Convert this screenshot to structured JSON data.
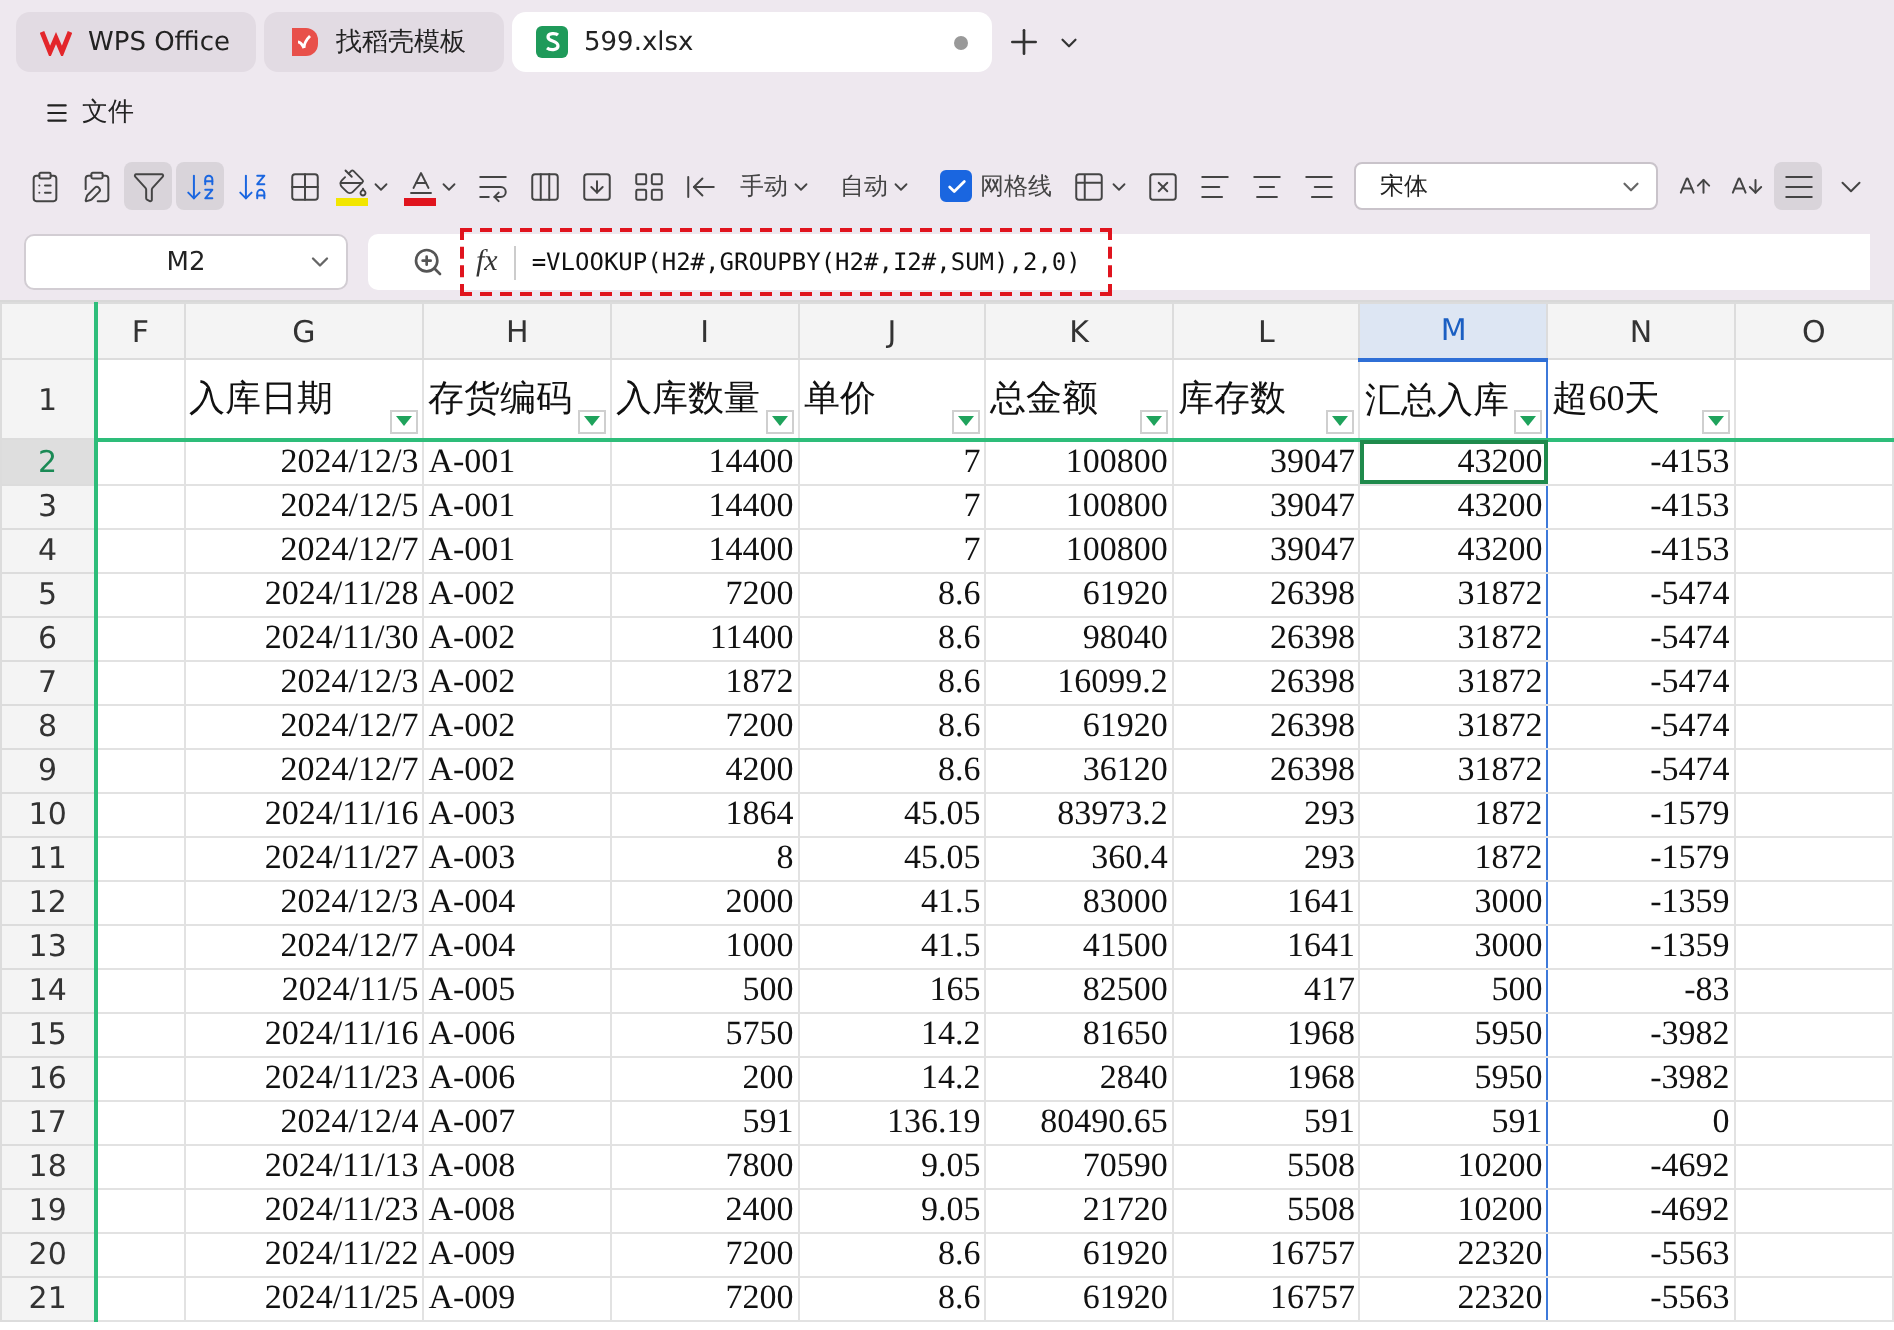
{
  "tabs": [
    {
      "label": "WPS Office",
      "kind": "wps",
      "selected": false,
      "modified": false
    },
    {
      "label": "找稻壳模板",
      "kind": "docer",
      "selected": false,
      "modified": false
    },
    {
      "label": "599.xlsx",
      "kind": "sheet",
      "selected": true,
      "modified": true
    }
  ],
  "menu": {
    "label": "文件"
  },
  "toolbar": {
    "items": [
      {
        "kind": "icon",
        "pressed": false
      },
      {
        "kind": "icon",
        "pressed": false
      },
      {
        "kind": "icon",
        "pressed": true
      },
      {
        "kind": "icon",
        "pressed": true
      },
      {
        "kind": "icon",
        "pressed": false
      },
      {
        "kind": "icon",
        "pressed": false
      },
      {
        "kind": "icon",
        "pressed": false
      },
      {
        "kind": "icon",
        "pressed": false
      },
      {
        "kind": "icon",
        "pressed": false
      },
      {
        "kind": "icon",
        "pressed": false
      },
      {
        "kind": "icon",
        "pressed": false
      },
      {
        "kind": "icon",
        "pressed": false
      },
      {
        "kind": "icon",
        "pressed": false
      },
      {
        "kind": "dropdown",
        "label": "手动"
      },
      {
        "kind": "dropdown",
        "label": "自动"
      },
      {
        "kind": "checkbox",
        "label": "网格线",
        "checked": true
      },
      {
        "kind": "icon",
        "pressed": false
      },
      {
        "kind": "icon",
        "pressed": false
      },
      {
        "kind": "icon",
        "pressed": false
      },
      {
        "kind": "icon",
        "pressed": false
      },
      {
        "kind": "icon",
        "pressed": false
      },
      {
        "kind": "font",
        "value": "宋体"
      },
      {
        "kind": "icon",
        "pressed": false
      },
      {
        "kind": "icon",
        "pressed": false
      },
      {
        "kind": "icon",
        "pressed": true
      },
      {
        "kind": "icon",
        "pressed": false
      }
    ]
  },
  "formula_bar": {
    "name_box": "M2",
    "fx": "fx",
    "formula": "=VLOOKUP(H2#,GROUPBY(H2#,I2#,SUM),2,0)",
    "highlighted": true
  },
  "sheet": {
    "columns": [
      {
        "letter": "F",
        "selected": false,
        "filter": false,
        "kind": "number"
      },
      {
        "letter": "G",
        "selected": false,
        "filter": true,
        "kind": "number"
      },
      {
        "letter": "H",
        "selected": false,
        "filter": true,
        "kind": "text"
      },
      {
        "letter": "I",
        "selected": false,
        "filter": true,
        "kind": "number"
      },
      {
        "letter": "J",
        "selected": false,
        "filter": true,
        "kind": "number"
      },
      {
        "letter": "K",
        "selected": false,
        "filter": true,
        "kind": "number"
      },
      {
        "letter": "L",
        "selected": false,
        "filter": true,
        "kind": "number"
      },
      {
        "letter": "M",
        "selected": true,
        "filter": true,
        "kind": "number"
      },
      {
        "letter": "N",
        "selected": false,
        "filter": true,
        "kind": "number"
      },
      {
        "letter": "O",
        "selected": false,
        "filter": false,
        "kind": "number"
      }
    ],
    "header_row": {
      "number": "1",
      "cells": [
        "",
        "入库日期",
        "存货编码",
        "入库数量",
        "单价",
        "总金额",
        "库存数",
        "汇总入库",
        "超60天"
      ]
    },
    "rows": [
      {
        "number": "2",
        "selected": true,
        "cells": [
          "",
          "2024/12/3",
          "A-001",
          "14400",
          "7",
          "100800",
          "39047",
          "43200",
          "-4153"
        ]
      },
      {
        "number": "3",
        "selected": false,
        "cells": [
          "",
          "2024/12/5",
          "A-001",
          "14400",
          "7",
          "100800",
          "39047",
          "43200",
          "-4153"
        ]
      },
      {
        "number": "4",
        "selected": false,
        "cells": [
          "",
          "2024/12/7",
          "A-001",
          "14400",
          "7",
          "100800",
          "39047",
          "43200",
          "-4153"
        ]
      },
      {
        "number": "5",
        "selected": false,
        "cells": [
          "",
          "2024/11/28",
          "A-002",
          "7200",
          "8.6",
          "61920",
          "26398",
          "31872",
          "-5474"
        ]
      },
      {
        "number": "6",
        "selected": false,
        "cells": [
          "",
          "2024/11/30",
          "A-002",
          "11400",
          "8.6",
          "98040",
          "26398",
          "31872",
          "-5474"
        ]
      },
      {
        "number": "7",
        "selected": false,
        "cells": [
          "",
          "2024/12/3",
          "A-002",
          "1872",
          "8.6",
          "16099.2",
          "26398",
          "31872",
          "-5474"
        ]
      },
      {
        "number": "8",
        "selected": false,
        "cells": [
          "",
          "2024/12/7",
          "A-002",
          "7200",
          "8.6",
          "61920",
          "26398",
          "31872",
          "-5474"
        ]
      },
      {
        "number": "9",
        "selected": false,
        "cells": [
          "",
          "2024/12/7",
          "A-002",
          "4200",
          "8.6",
          "36120",
          "26398",
          "31872",
          "-5474"
        ]
      },
      {
        "number": "10",
        "selected": false,
        "cells": [
          "",
          "2024/11/16",
          "A-003",
          "1864",
          "45.05",
          "83973.2",
          "293",
          "1872",
          "-1579"
        ]
      },
      {
        "number": "11",
        "selected": false,
        "cells": [
          "",
          "2024/11/27",
          "A-003",
          "8",
          "45.05",
          "360.4",
          "293",
          "1872",
          "-1579"
        ]
      },
      {
        "number": "12",
        "selected": false,
        "cells": [
          "",
          "2024/12/3",
          "A-004",
          "2000",
          "41.5",
          "83000",
          "1641",
          "3000",
          "-1359"
        ]
      },
      {
        "number": "13",
        "selected": false,
        "cells": [
          "",
          "2024/12/7",
          "A-004",
          "1000",
          "41.5",
          "41500",
          "1641",
          "3000",
          "-1359"
        ]
      },
      {
        "number": "14",
        "selected": false,
        "cells": [
          "",
          "2024/11/5",
          "A-005",
          "500",
          "165",
          "82500",
          "417",
          "500",
          "-83"
        ]
      },
      {
        "number": "15",
        "selected": false,
        "cells": [
          "",
          "2024/11/16",
          "A-006",
          "5750",
          "14.2",
          "81650",
          "1968",
          "5950",
          "-3982"
        ]
      },
      {
        "number": "16",
        "selected": false,
        "cells": [
          "",
          "2024/11/23",
          "A-006",
          "200",
          "14.2",
          "2840",
          "1968",
          "5950",
          "-3982"
        ]
      },
      {
        "number": "17",
        "selected": false,
        "cells": [
          "",
          "2024/12/4",
          "A-007",
          "591",
          "136.19",
          "80490.65",
          "591",
          "591",
          "0"
        ]
      },
      {
        "number": "18",
        "selected": false,
        "cells": [
          "",
          "2024/11/13",
          "A-008",
          "7800",
          "9.05",
          "70590",
          "5508",
          "10200",
          "-4692"
        ]
      },
      {
        "number": "19",
        "selected": false,
        "cells": [
          "",
          "2024/11/23",
          "A-008",
          "2400",
          "9.05",
          "21720",
          "5508",
          "10200",
          "-4692"
        ]
      },
      {
        "number": "20",
        "selected": false,
        "cells": [
          "",
          "2024/11/22",
          "A-009",
          "7200",
          "8.6",
          "61920",
          "16757",
          "22320",
          "-5563"
        ]
      },
      {
        "number": "21",
        "selected": false,
        "cells": [
          "",
          "2024/11/25",
          "A-009",
          "7200",
          "8.6",
          "61920",
          "16757",
          "22320",
          "-5563"
        ]
      }
    ]
  }
}
